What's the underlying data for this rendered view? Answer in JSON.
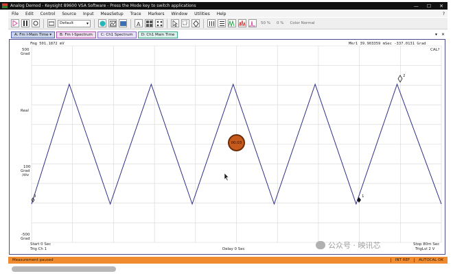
{
  "window": {
    "title": "Analog Demod - Keysight 89600 VSA Software - Press the Mode key to switch applications",
    "minimize": "—",
    "restore": "☐",
    "close": "✕"
  },
  "menu": {
    "items": [
      "File",
      "Edit",
      "Control",
      "Source",
      "Input",
      "MeasSetup",
      "Trace",
      "Markers",
      "Window",
      "Utilities",
      "Help"
    ],
    "help": "?"
  },
  "toolbar": {
    "preset": "Default",
    "zoom_readout": "50 %",
    "offset_readout": "0 %",
    "color_scheme": "Color Normal"
  },
  "tabs": [
    {
      "label": "A: Fm I-Main Time",
      "arrow": "▾"
    },
    {
      "label": "B: Fm I-Spectrum"
    },
    {
      "label": "C: Ch1 Spectrum"
    },
    {
      "label": "D: Ch1 Main Time"
    }
  ],
  "tab_controls": {
    "dropdown": "▾",
    "close": "✕"
  },
  "trace": {
    "header_left": "Fmg 501.1872 mV",
    "marker_readout": "Mkr1   39.903359 mSec      -337.0131 Grad",
    "cal_status": "CAL?",
    "y_top": "500",
    "y_top_unit": "Grad",
    "format_label": "Real",
    "y_scale": "100",
    "y_scale_unit": "Grad",
    "y_scale_per": "/div",
    "y_bottom": "-500",
    "y_bottom_unit": "Grad",
    "start_label": "Start 0  Sec",
    "trig_left": "Trig Ch 1",
    "delay_label": "Delay 0  Sec",
    "stop_label": "Stop 80m Sec",
    "trig_right": "TrigLvl 2  V",
    "marker_labels": [
      "3",
      "1",
      "2"
    ],
    "line_color": "#2e2e86",
    "grid_color": "#d6d6d6"
  },
  "badge": {
    "text": "00:03"
  },
  "watermark": {
    "text": "公众号 · 映讯芯"
  },
  "status": {
    "message": "Measurement paused",
    "ref": "INT REF",
    "autocal": "AUTOCAL OK"
  }
}
